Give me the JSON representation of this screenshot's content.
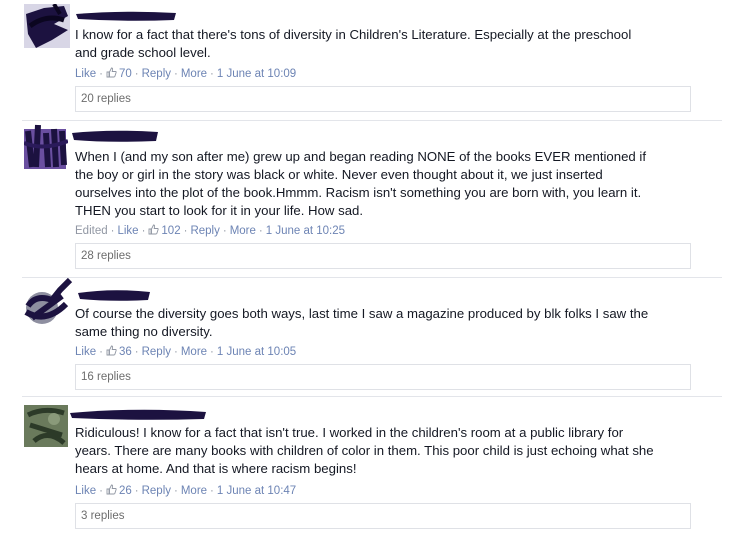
{
  "comments": [
    {
      "text": "I know for a fact that there's tons of diversity in Children's Literature. Especially at the preschool\nand grade school level.",
      "edited": "",
      "like": "Like",
      "like_count": "70",
      "reply": "Reply",
      "more": "More",
      "timestamp": "1 June at 10:09",
      "replies": "20 replies"
    },
    {
      "text": "When I (and my son after me) grew up and began reading NONE of the books EVER mentioned if\nthe boy or girl in the story was black or white. Never even thought about it, we just inserted\nourselves into the plot of the book.Hmmm. Racism isn't something you are born with, you learn it.\nTHEN you start to look for it in your life. How sad.",
      "edited": "Edited",
      "like": "Like",
      "like_count": "102",
      "reply": "Reply",
      "more": "More",
      "timestamp": "1 June at 10:25",
      "replies": "28 replies"
    },
    {
      "text": "Of course the diversity goes both ways, last time I saw a magazine produced by blk folks I saw the\nsame thing no diversity.",
      "edited": "",
      "like": "Like",
      "like_count": "36",
      "reply": "Reply",
      "more": "More",
      "timestamp": "1 June at 10:05",
      "replies": "16 replies"
    },
    {
      "text": "Ridiculous! I know for a fact that isn't true. I worked in the children's room at a public library for\nyears. There are many books with children of color in them. This poor child is just echoing what she\nhears at home. And that is where racism begins!",
      "edited": "",
      "like": "Like",
      "like_count": "26",
      "reply": "Reply",
      "more": "More",
      "timestamp": "1 June at 10:47",
      "replies": "3 replies"
    }
  ],
  "separator": "·",
  "icons": {
    "like": "thumbs-up-icon",
    "avatar_redaction": "redacted-avatar",
    "name_redaction": "redacted-name"
  },
  "colors": {
    "link": "#6d84b4",
    "meta": "#9197a3",
    "text": "#141823",
    "redaction": "#1c1240"
  }
}
